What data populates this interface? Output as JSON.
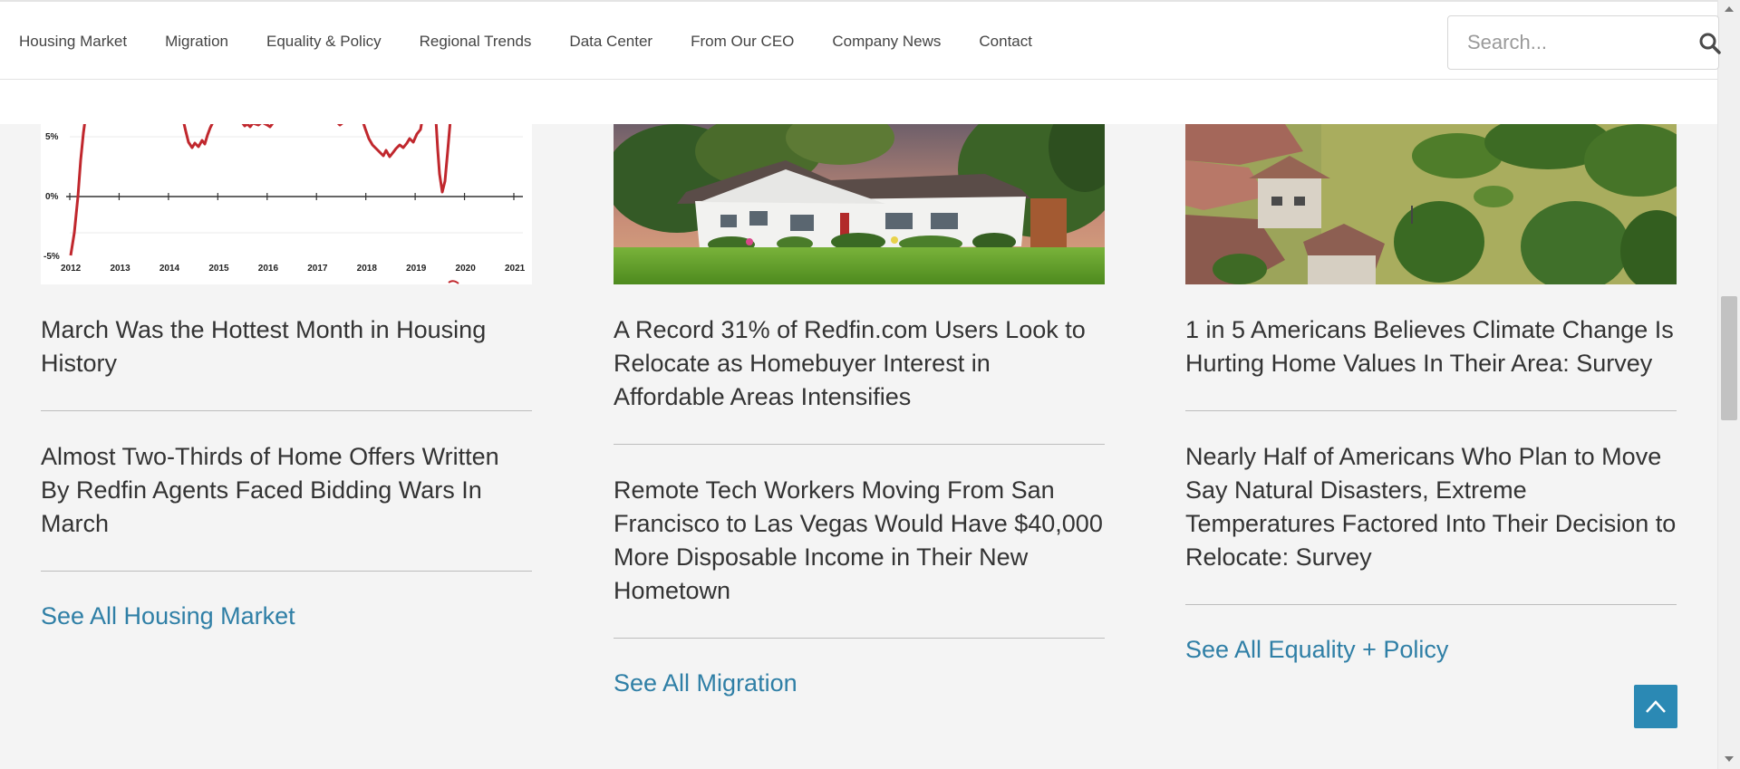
{
  "nav": {
    "items": [
      {
        "label": "Housing Market"
      },
      {
        "label": "Migration"
      },
      {
        "label": "Equality & Policy"
      },
      {
        "label": "Regional Trends"
      },
      {
        "label": "Data Center"
      },
      {
        "label": "From Our CEO"
      },
      {
        "label": "Company News"
      },
      {
        "label": "Contact"
      }
    ],
    "search": {
      "placeholder": "Search...",
      "icon": "search-icon"
    }
  },
  "columns": [
    {
      "thumb": {
        "type": "line-chart",
        "y_ticks": [
          "5%",
          "0%",
          "-5%"
        ],
        "x_ticks": [
          "2012",
          "2013",
          "2014",
          "2015",
          "2016",
          "2017",
          "2018",
          "2019",
          "2020",
          "2021"
        ],
        "line_color": "#c0272d"
      },
      "articles": [
        {
          "title": "March Was the Hottest Month in Housing History"
        },
        {
          "title": "Almost Two-Thirds of Home Offers Written By Redfin Agents Faced Bidding Wars In March"
        }
      ],
      "see_all": "See All Housing Market"
    },
    {
      "thumb": {
        "type": "photo",
        "subject": "house-photo"
      },
      "articles": [
        {
          "title": "A Record 31% of Redfin.com Users Look to Relocate as Homebuyer Interest in Affordable Areas Intensifies"
        },
        {
          "title": "Remote Tech Workers Moving From San Francisco to Las Vegas Would Have $40,000 More Disposable Income in Their New Hometown"
        }
      ],
      "see_all": "See All Migration"
    },
    {
      "thumb": {
        "type": "photo",
        "subject": "flood-photo"
      },
      "articles": [
        {
          "title": "1 in 5 Americans Believes Climate Change Is Hurting Home Values In Their Area: Survey"
        },
        {
          "title": "Nearly Half of Americans Who Plan to Move Say Natural Disasters, Extreme Temperatures Factored Into Their Decision to Relocate: Survey"
        }
      ],
      "see_all": "See All Equality + Policy"
    }
  ],
  "colors": {
    "link": "#2f7fa6",
    "accent": "#2b89b4",
    "text": "#333333",
    "background": "#f4f4f4"
  },
  "scroll_top": {
    "icon": "chevron-up-icon"
  }
}
